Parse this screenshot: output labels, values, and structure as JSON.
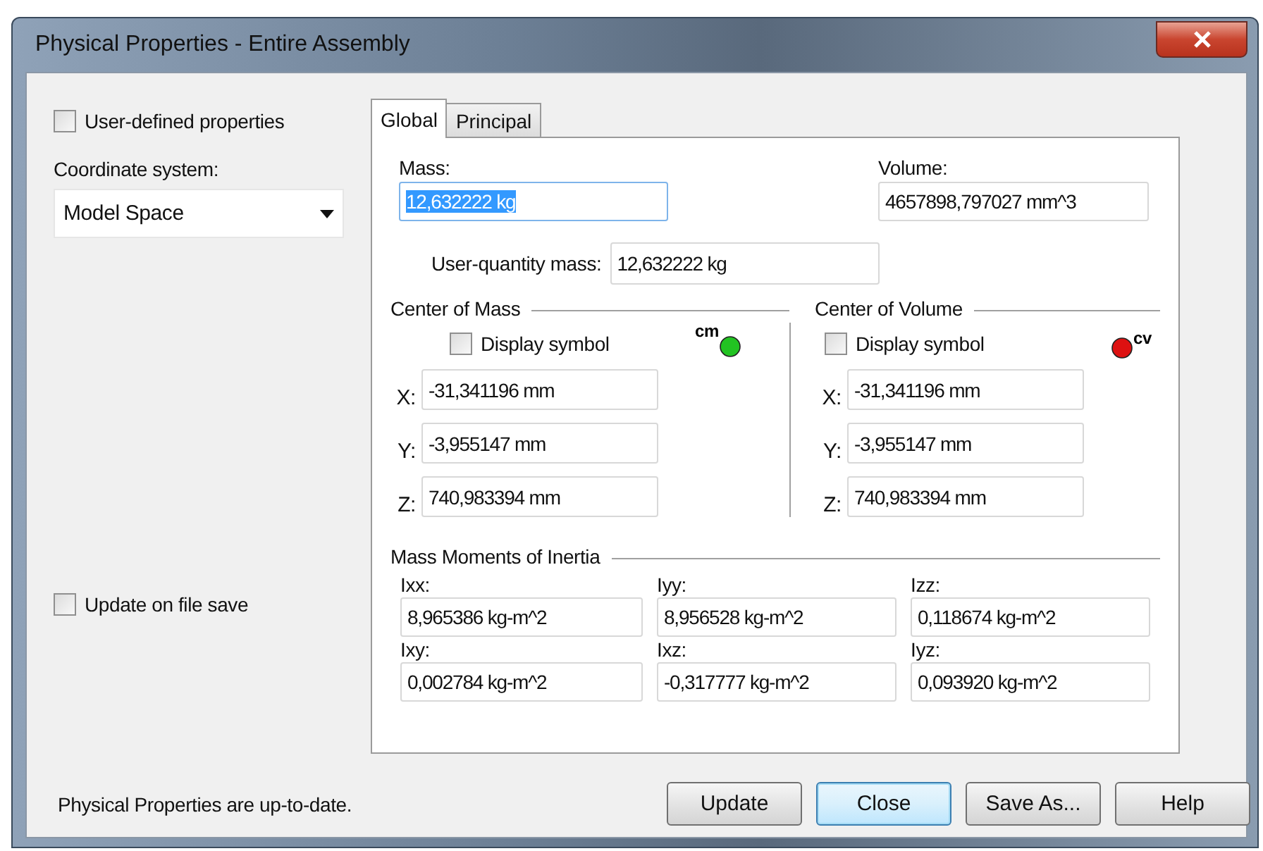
{
  "window": {
    "title": "Physical Properties - Entire Assembly"
  },
  "left_panel": {
    "user_defined": {
      "label": "User-defined properties",
      "checked": false
    },
    "coordinate_label": "Coordinate system:",
    "coordinate_value": "Model Space",
    "update_on_save": {
      "label": "Update on file save",
      "checked": false
    }
  },
  "tabs": [
    {
      "label": "Global",
      "selected": true
    },
    {
      "label": "Principal",
      "selected": false
    }
  ],
  "mass": {
    "label": "Mass:",
    "value": "12,632222 kg",
    "highlighted": true
  },
  "volume": {
    "label": "Volume:",
    "value": "4657898,797027 mm^3"
  },
  "user_quantity_mass": {
    "label": "User-quantity mass:",
    "value": "12,632222 kg"
  },
  "centers": [
    {
      "title": "Center of Mass",
      "display_symbol": {
        "label": "Display symbol",
        "checked": false
      },
      "symbol": {
        "kind": "above",
        "text": "cm",
        "color": "#22c322"
      },
      "coords": [
        {
          "axis": "X:",
          "value": "-31,341196 mm"
        },
        {
          "axis": "Y:",
          "value": "-3,955147 mm"
        },
        {
          "axis": "Z:",
          "value": "740,983394 mm"
        }
      ]
    },
    {
      "title": "Center of Volume",
      "display_symbol": {
        "label": "Display symbol",
        "checked": false
      },
      "symbol": {
        "kind": "after",
        "text": "cv",
        "color": "#dd1111"
      },
      "coords": [
        {
          "axis": "X:",
          "value": "-31,341196 mm"
        },
        {
          "axis": "Y:",
          "value": "-3,955147 mm"
        },
        {
          "axis": "Z:",
          "value": "740,983394 mm"
        }
      ]
    }
  ],
  "inertia": {
    "title": "Mass Moments of Inertia",
    "items": [
      {
        "label": "Ixx:",
        "value": "8,965386 kg-m^2"
      },
      {
        "label": "Iyy:",
        "value": "8,956528 kg-m^2"
      },
      {
        "label": "Izz:",
        "value": "0,118674 kg-m^2"
      },
      {
        "label": "Ixy:",
        "value": "0,002784 kg-m^2"
      },
      {
        "label": "Ixz:",
        "value": "-0,317777 kg-m^2"
      },
      {
        "label": "Iyz:",
        "value": "0,093920 kg-m^2"
      }
    ]
  },
  "status": "Physical Properties are up-to-date.",
  "buttons": [
    {
      "label": "Update",
      "default": false
    },
    {
      "label": "Close",
      "default": true
    },
    {
      "label": "Save As...",
      "default": false
    },
    {
      "label": "Help",
      "default": false
    }
  ]
}
